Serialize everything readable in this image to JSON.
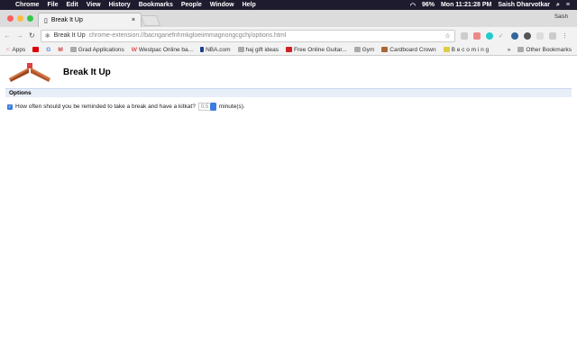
{
  "menubar": {
    "app": "Chrome",
    "items": [
      "File",
      "Edit",
      "View",
      "History",
      "Bookmarks",
      "People",
      "Window",
      "Help"
    ],
    "battery": "96%",
    "clock": "Mon 11:21:28 PM",
    "user": "Saish Dharvotkar"
  },
  "tab": {
    "title": "Break It Up",
    "close": "×"
  },
  "profile": "Saish",
  "omnibox": {
    "host": "Break It Up",
    "url": "chrome-extension://bacnganefnhmkgloeiimmagnongcgchj/options.html"
  },
  "bookmarks": [
    "Apps",
    "Grad Applications",
    "Westpac Online ba...",
    "NBA.com",
    "haj gift ideas",
    "Free Online Guitar...",
    "Gym",
    "Cardboard Crown",
    "B e c o m i n g"
  ],
  "other_bookmarks": "Other Bookmarks",
  "page": {
    "title": "Break It Up",
    "section": "Options",
    "question": "How often should you be reminded to take a break and have a kitkat?",
    "value": "0.5",
    "unit": "minute(s).",
    "checked": true
  }
}
